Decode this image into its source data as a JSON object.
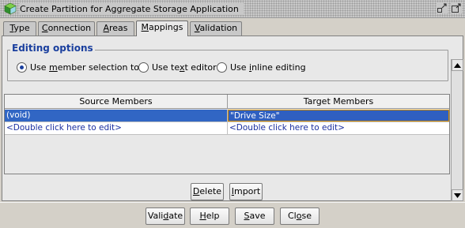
{
  "window": {
    "title": "Create Partition for Aggregate Storage Application"
  },
  "tabs": [
    {
      "pre": "",
      "mn": "T",
      "post": "ype"
    },
    {
      "pre": "",
      "mn": "C",
      "post": "onnection"
    },
    {
      "pre": "",
      "mn": "A",
      "post": "reas"
    },
    {
      "pre": "",
      "mn": "M",
      "post": "appings"
    },
    {
      "pre": "",
      "mn": "V",
      "post": "alidation"
    }
  ],
  "active_tab": "Mappings",
  "editing_options": {
    "title": "Editing options",
    "options": [
      {
        "pre": "Use ",
        "mn": "m",
        "post": "ember selection tool",
        "checked": true
      },
      {
        "pre": "Use te",
        "mn": "x",
        "post": "t editor",
        "checked": false
      },
      {
        "pre": "Use ",
        "mn": "i",
        "post": "nline editing",
        "checked": false
      }
    ]
  },
  "mappings_table": {
    "columns": [
      "Source Members",
      "Target Members"
    ],
    "rows": [
      {
        "source": "(void)",
        "target": "\"Drive Size\""
      },
      {
        "source": "<Double click here to edit>",
        "target": "<Double click here to edit>"
      }
    ]
  },
  "table_buttons": {
    "delete": {
      "pre": "",
      "mn": "D",
      "post": "elete"
    },
    "import": {
      "pre": "",
      "mn": "I",
      "post": "mport"
    }
  },
  "footer_buttons": {
    "validate": {
      "pre": "Vali",
      "mn": "d",
      "post": "ate"
    },
    "help": {
      "pre": "",
      "mn": "H",
      "post": "elp"
    },
    "save": {
      "pre": "",
      "mn": "S",
      "post": "ave"
    },
    "close": {
      "pre": "Cl",
      "mn": "o",
      "post": "se"
    }
  },
  "colors": {
    "selection": "#3166c4",
    "group_title": "#1a3f9e",
    "link_text": "#1a2fa0"
  }
}
